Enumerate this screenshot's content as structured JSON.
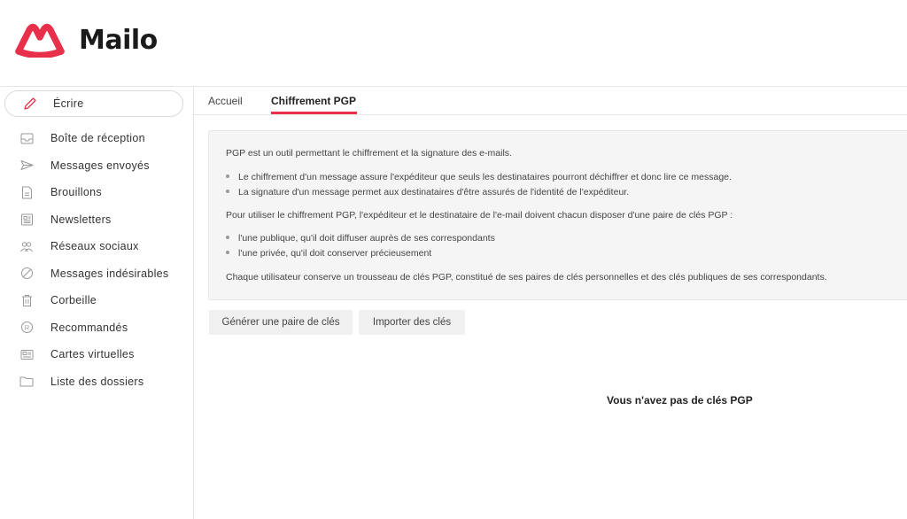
{
  "app": {
    "name": "Mailo",
    "brand_color": "#e8304a"
  },
  "sidebar": {
    "compose": {
      "label": "Écrire",
      "icon": "pencil-icon"
    },
    "items": [
      {
        "label": "Boîte de réception",
        "icon": "inbox-icon"
      },
      {
        "label": "Messages envoyés",
        "icon": "send-icon"
      },
      {
        "label": "Brouillons",
        "icon": "draft-icon"
      },
      {
        "label": "Newsletters",
        "icon": "newsletter-icon"
      },
      {
        "label": "Réseaux sociaux",
        "icon": "people-icon"
      },
      {
        "label": "Messages indésirables",
        "icon": "spam-icon"
      },
      {
        "label": "Corbeille",
        "icon": "trash-icon"
      },
      {
        "label": "Recommandés",
        "icon": "registered-icon"
      },
      {
        "label": "Cartes virtuelles",
        "icon": "card-icon"
      },
      {
        "label": "Liste des dossiers",
        "icon": "folder-icon"
      }
    ]
  },
  "tabs": [
    {
      "label": "Accueil",
      "active": false
    },
    {
      "label": "Chiffrement PGP",
      "active": true
    }
  ],
  "info": {
    "intro": "PGP est un outil permettant le chiffrement et la signature des e-mails.",
    "bullets1": [
      "Le chiffrement d'un message assure l'expéditeur que seuls les destinataires pourront déchiffrer et donc lire ce message.",
      "La signature d'un message permet aux destinataires d'être assurés de l'identité de l'expéditeur."
    ],
    "requirement": "Pour utiliser le chiffrement PGP, l'expéditeur et le destinataire de l'e-mail doivent chacun disposer d'une paire de clés PGP :",
    "bullets2": [
      "l'une publique, qu'il doit diffuser auprès de ses correspondants",
      "l'une privée, qu'il doit conserver précieusement"
    ],
    "keyring": "Chaque utilisateur conserve un trousseau de clés PGP, constitué de ses paires de clés personnelles et des clés publiques de ses correspondants."
  },
  "actions": {
    "generate_label": "Générer une paire de clés",
    "import_label": "Importer des clés"
  },
  "empty_state": "Vous n'avez pas de clés PGP"
}
